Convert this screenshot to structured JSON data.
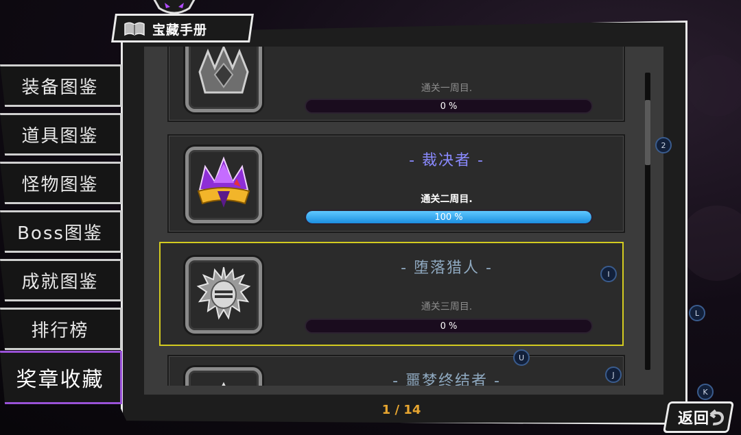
{
  "header": {
    "title": "宝藏手册",
    "icon": "book-icon"
  },
  "sidebar": {
    "items": [
      {
        "label": "装备图鉴",
        "active": false
      },
      {
        "label": "道具图鉴",
        "active": false
      },
      {
        "label": "怪物图鉴",
        "active": false
      },
      {
        "label": "Boss图鉴",
        "active": false
      },
      {
        "label": "成就图鉴",
        "active": false
      },
      {
        "label": "排行榜",
        "active": false
      },
      {
        "label": "奖章收藏",
        "active": true
      }
    ]
  },
  "medals": [
    {
      "name": "",
      "condition": "通关一周目.",
      "progress": 0,
      "progress_text": "0 %",
      "unlocked": false,
      "icon": "dark-crown-icon"
    },
    {
      "name": "- 裁决者 -",
      "condition": "通关二周目.",
      "progress": 1.0,
      "progress_text": "100 %",
      "unlocked": true,
      "icon": "purple-crown-icon"
    },
    {
      "name": "- 堕落猎人 -",
      "condition": "通关三周目.",
      "progress": 0,
      "progress_text": "0 %",
      "unlocked": false,
      "selected": true,
      "icon": "knight-helmet-icon"
    },
    {
      "name": "- 噩梦终结者 -",
      "condition": "",
      "progress": 0,
      "progress_text": "",
      "unlocked": false,
      "icon": "silver-crown-icon"
    }
  ],
  "pagination": {
    "text": "1 / 14"
  },
  "hotkeys": {
    "scroll_up": "2",
    "info": "I",
    "next": "L",
    "down": "U",
    "select": "J",
    "back": "K"
  },
  "back_button": {
    "label": "返回"
  },
  "colors": {
    "accent_purple": "#9a52d8",
    "selected_yellow": "#d4cc20",
    "progress_blue": "#1c8fe0",
    "unlocked_name": "#8a8aff",
    "page_orange": "#e8a630"
  }
}
